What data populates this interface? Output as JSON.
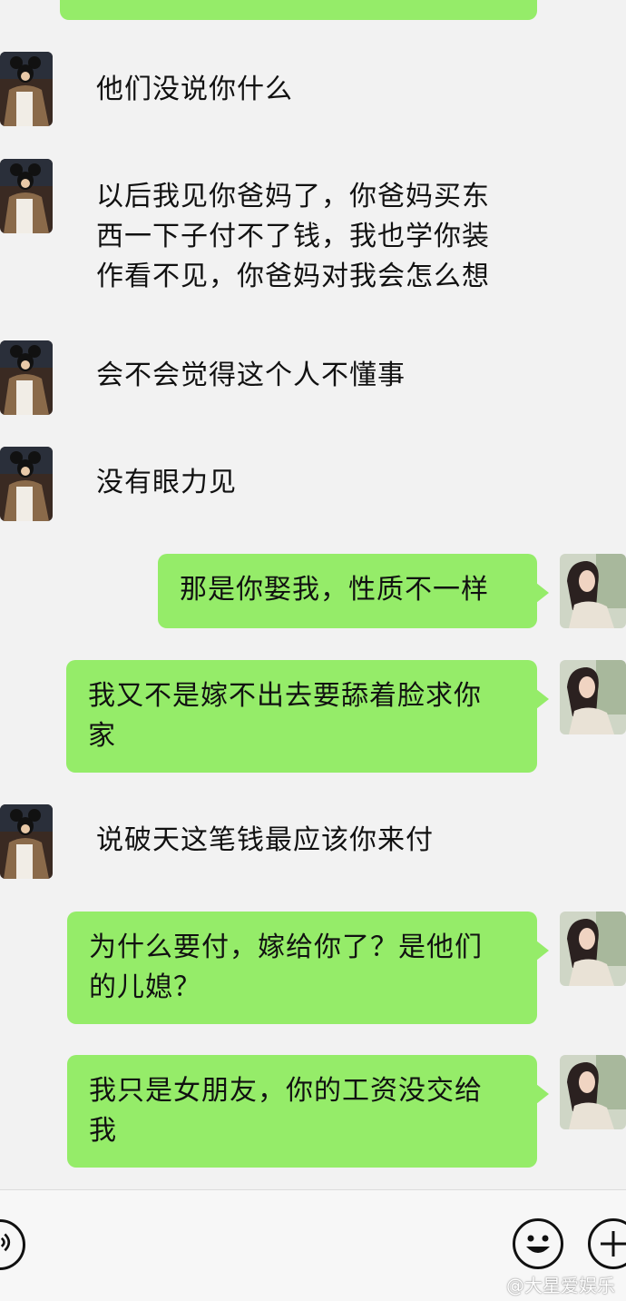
{
  "messages": [
    {
      "side": "left",
      "text": "他们没说你什么"
    },
    {
      "side": "left",
      "lines": [
        "以后我见你爸妈了，你爸妈买东",
        "西一下子付不了钱，我也学你装",
        "作看不见，你爸妈对我会怎么想"
      ]
    },
    {
      "side": "left",
      "text": "会不会觉得这个人不懂事"
    },
    {
      "side": "left",
      "text": "没有眼力见"
    },
    {
      "side": "right",
      "lines": [
        "那是你娶我，性质不一样"
      ]
    },
    {
      "side": "right",
      "lines": [
        "我又不是嫁不出去要舔着脸求你",
        "家"
      ]
    },
    {
      "side": "left",
      "text": "说破天这笔钱最应该你来付"
    },
    {
      "side": "right",
      "lines": [
        "为什么要付，嫁给你了？是他们",
        "的儿媳？"
      ]
    },
    {
      "side": "right",
      "lines": [
        "我只是女朋友，你的工资没交给",
        "我"
      ]
    }
  ],
  "input_bar": {
    "voice_icon": "voice-icon",
    "emoji_icon": "emoji-icon",
    "plus_icon": "plus-icon"
  },
  "watermark": "@大星爱娱乐",
  "colors": {
    "bubble_green": "#95ec69",
    "background": "#f2f2f2"
  }
}
